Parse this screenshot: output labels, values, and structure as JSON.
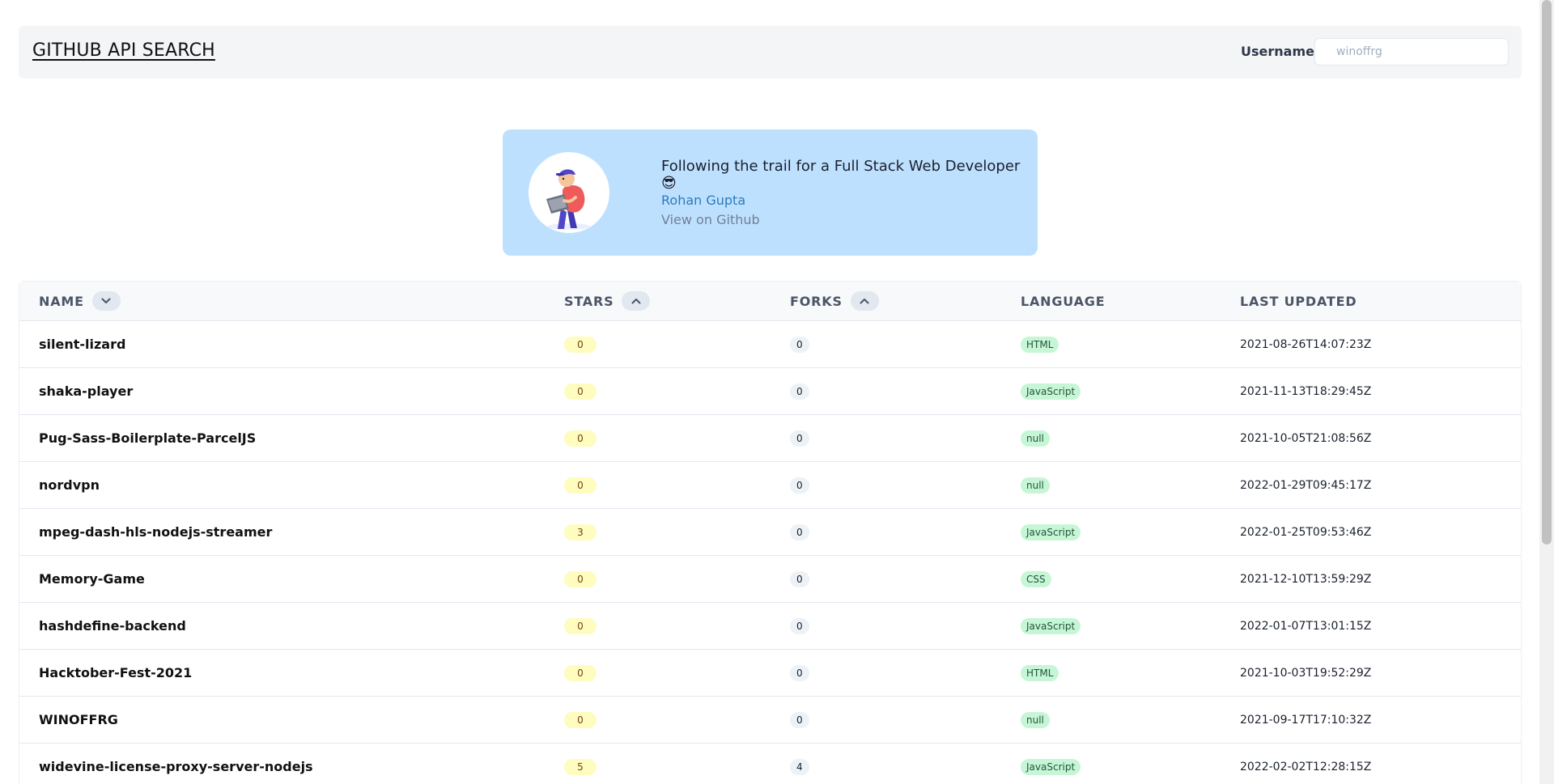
{
  "header": {
    "title": "GITHUB API SEARCH",
    "username_label": "Username",
    "username_placeholder": "winoffrg"
  },
  "profile": {
    "bio": "Following the trail for a Full Stack Web Developer 😎",
    "name": "Rohan Gupta",
    "link_label": "View on Github",
    "avatar_icon": "developer-avatar-illustration"
  },
  "table": {
    "columns": {
      "name": "NAME",
      "stars": "STARS",
      "forks": "FORKS",
      "language": "LANGUAGE",
      "last_updated": "LAST UPDATED"
    },
    "sort_icons": {
      "name": "chevron-down-icon",
      "stars": "chevron-up-icon",
      "forks": "chevron-up-icon"
    },
    "rows": [
      {
        "name": "silent-lizard",
        "stars": "0",
        "forks": "0",
        "language": "HTML",
        "updated": "2021-08-26T14:07:23Z"
      },
      {
        "name": "shaka-player",
        "stars": "0",
        "forks": "0",
        "language": "JavaScript",
        "updated": "2021-11-13T18:29:45Z"
      },
      {
        "name": "Pug-Sass-Boilerplate-ParcelJS",
        "stars": "0",
        "forks": "0",
        "language": "null",
        "updated": "2021-10-05T21:08:56Z"
      },
      {
        "name": "nordvpn",
        "stars": "0",
        "forks": "0",
        "language": "null",
        "updated": "2022-01-29T09:45:17Z"
      },
      {
        "name": "mpeg-dash-hls-nodejs-streamer",
        "stars": "3",
        "forks": "0",
        "language": "JavaScript",
        "updated": "2022-01-25T09:53:46Z"
      },
      {
        "name": "Memory-Game",
        "stars": "0",
        "forks": "0",
        "language": "CSS",
        "updated": "2021-12-10T13:59:29Z"
      },
      {
        "name": "hashdefine-backend",
        "stars": "0",
        "forks": "0",
        "language": "JavaScript",
        "updated": "2022-01-07T13:01:15Z"
      },
      {
        "name": "Hacktober-Fest-2021",
        "stars": "0",
        "forks": "0",
        "language": "HTML",
        "updated": "2021-10-03T19:52:29Z"
      },
      {
        "name": "WINOFFRG",
        "stars": "0",
        "forks": "0",
        "language": "null",
        "updated": "2021-09-17T17:10:32Z"
      },
      {
        "name": "widevine-license-proxy-server-nodejs",
        "stars": "5",
        "forks": "4",
        "language": "JavaScript",
        "updated": "2022-02-02T12:28:15Z"
      }
    ]
  },
  "colors": {
    "card_bg": "#bee0ff",
    "star_badge": "#fefcbf",
    "lang_badge": "#c6f6d5",
    "link": "#2b7bb9"
  }
}
